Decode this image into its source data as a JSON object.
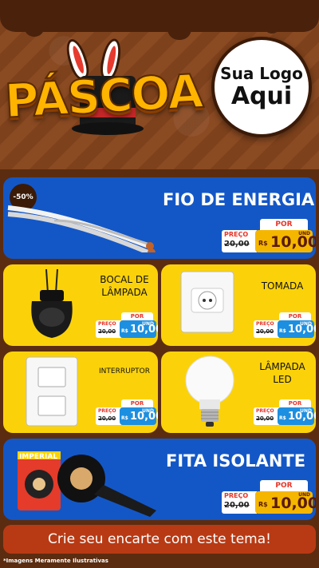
{
  "header": {
    "title": "PÁSCOA",
    "logo_line1": "Sua Logo",
    "logo_line2": "Aqui"
  },
  "products": {
    "fio": {
      "name": "FIO DE ENERGIA",
      "discount": "-50%",
      "old_price": "20,00",
      "new_price": "10,00"
    },
    "bocal": {
      "name_line1": "BOCAL DE",
      "name_line2": "LÂMPADA",
      "old_price": "20,00",
      "new_price": "10,00"
    },
    "tomada": {
      "name": "TOMADA",
      "old_price": "20,00",
      "new_price": "10,00"
    },
    "interruptor": {
      "name": "INTERRUPTOR",
      "old_price": "20,00",
      "new_price": "10,00"
    },
    "lampada": {
      "name_line1": "LÂMPADA",
      "name_line2": "LED",
      "old_price": "20,00",
      "new_price": "10,00"
    },
    "fita": {
      "name": "FITA ISOLANTE",
      "brand": "IMPERIAL",
      "old_price": "20,00",
      "new_price": "10,00"
    }
  },
  "labels": {
    "por": "POR",
    "preco": "PREÇO",
    "rs": "R$",
    "und": "UND"
  },
  "footer": {
    "cta": "Crie seu encarte com este tema!",
    "disclaimer": "*Imagens Meramente Ilustrativas"
  }
}
